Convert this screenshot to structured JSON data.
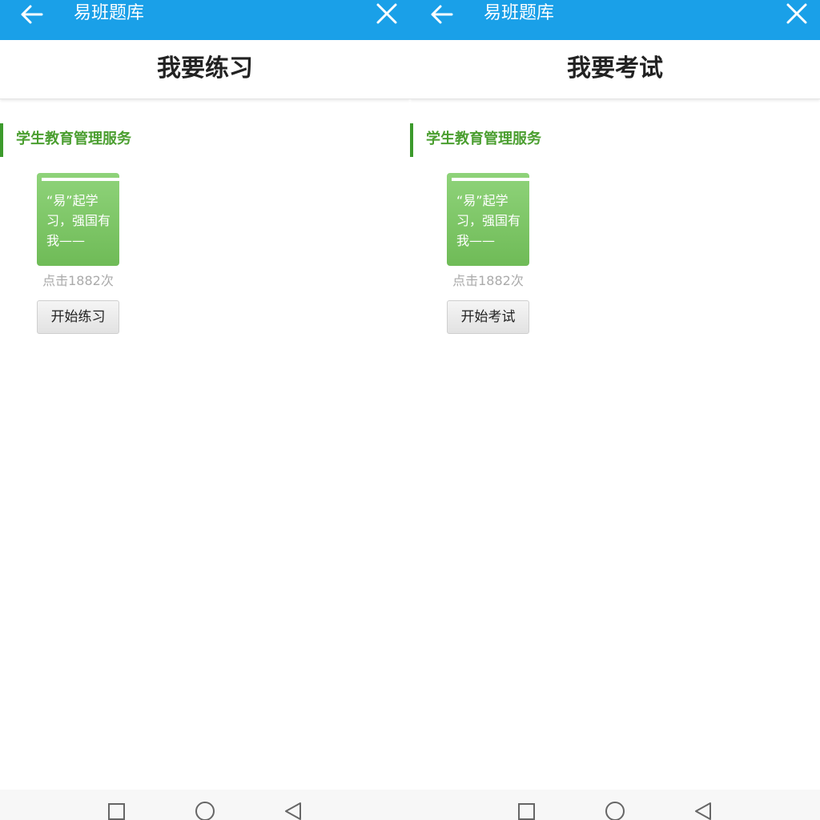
{
  "screens": [
    {
      "app_title": "易班题库",
      "page_title": "我要练习",
      "section_title": "学生教育管理服务",
      "book": {
        "title": "“易”起学习，强国有我——",
        "click_count": "点击1882次"
      },
      "start_button": "开始练习"
    },
    {
      "app_title": "易班题库",
      "page_title": "我要考试",
      "section_title": "学生教育管理服务",
      "book": {
        "title": "“易”起学习，强国有我——",
        "click_count": "点击1882次"
      },
      "start_button": "开始考试"
    }
  ],
  "icons": {
    "back": "arrow-left-icon",
    "close": "close-icon",
    "nav_recent": "square-icon",
    "nav_home": "circle-icon",
    "nav_back": "triangle-left-icon"
  },
  "colors": {
    "topbar": "#1aa0e8",
    "section_accent": "#4a9e2f",
    "book_cover": "#7ec766",
    "click_count": "#aaaaaa"
  }
}
